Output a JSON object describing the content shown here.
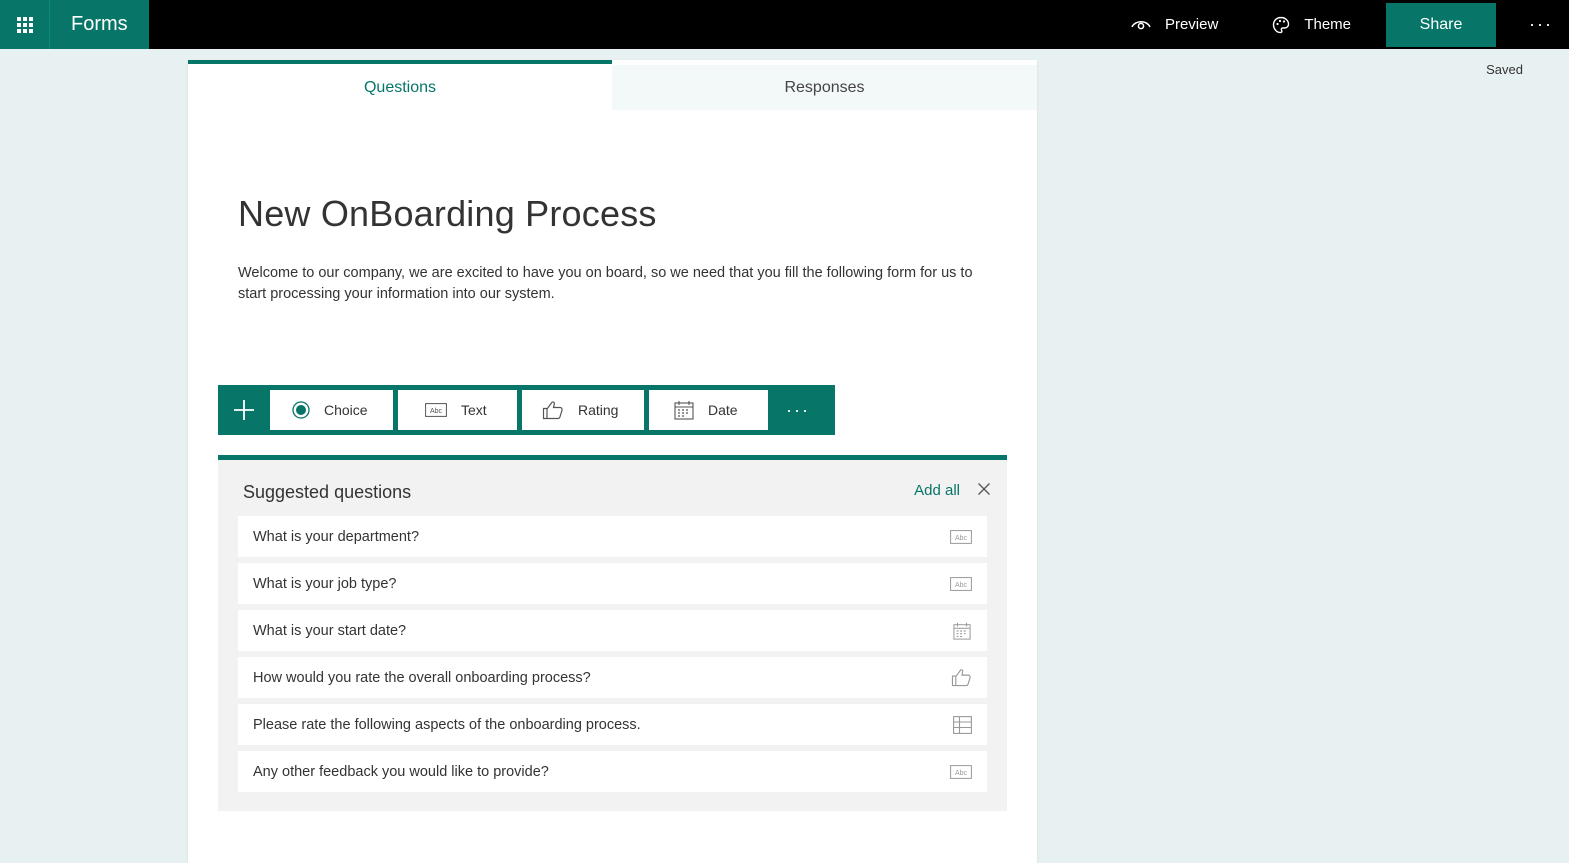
{
  "app": {
    "name": "Forms"
  },
  "header": {
    "preview_label": "Preview",
    "theme_label": "Theme",
    "share_label": "Share",
    "more_label": "···",
    "status": "Saved"
  },
  "tabs": [
    {
      "label": "Questions",
      "active": true
    },
    {
      "label": "Responses",
      "active": false
    }
  ],
  "form": {
    "title": "New OnBoarding Process",
    "description": "Welcome to our company, we are excited to have you on board, so we need that you fill the following form for us to start processing your information into our system."
  },
  "toolbar": {
    "types": [
      {
        "label": "Choice",
        "icon": "radio-icon"
      },
      {
        "label": "Text",
        "icon": "text-abc-icon"
      },
      {
        "label": "Rating",
        "icon": "thumbs-up-icon"
      },
      {
        "label": "Date",
        "icon": "calendar-icon"
      }
    ],
    "more_label": "···"
  },
  "suggested": {
    "title": "Suggested questions",
    "add_all_label": "Add all",
    "items": [
      {
        "label": "What is your department?",
        "icon": "text-abc-icon"
      },
      {
        "label": "What is your job type?",
        "icon": "text-abc-icon"
      },
      {
        "label": "What is your start date?",
        "icon": "calendar-icon"
      },
      {
        "label": "How would you rate the overall onboarding process?",
        "icon": "thumbs-up-icon"
      },
      {
        "label": "Please rate the following aspects of the onboarding process.",
        "icon": "grid-icon"
      },
      {
        "label": "Any other feedback you would like to provide?",
        "icon": "text-abc-icon"
      }
    ]
  },
  "colors": {
    "accent": "#077568",
    "topbar": "#000000",
    "background": "#e8f1f2"
  }
}
